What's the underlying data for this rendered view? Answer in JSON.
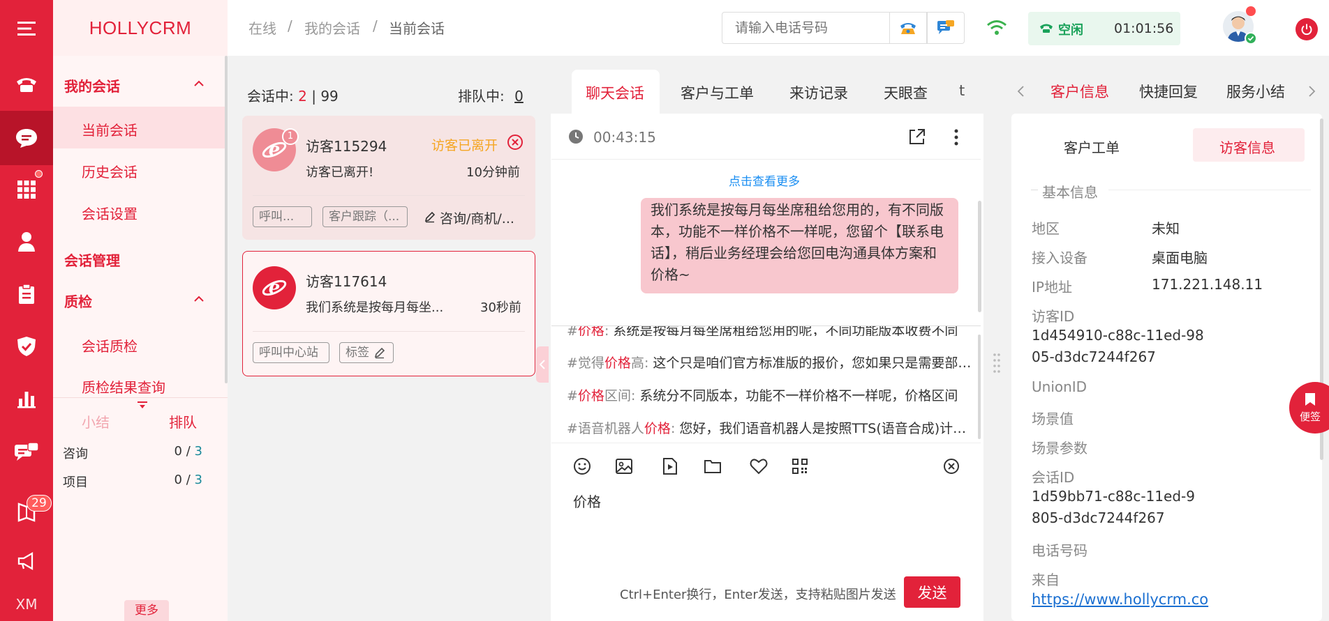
{
  "app": {
    "brand": "HOLLYCRM"
  },
  "colors": {
    "primary": "#e2223a",
    "online": "#1aa25a",
    "link": "#1a8ef2"
  },
  "rail": {
    "icons": [
      "menu-icon",
      "phone-icon",
      "chat-icon",
      "apps-icon",
      "user-icon",
      "clipboard-icon",
      "shield-icon",
      "chart-icon",
      "message-icon",
      "book-icon",
      "megaphone-icon"
    ],
    "badge": "29",
    "footer": "XM"
  },
  "nav": {
    "my_sessions": "我的会话",
    "current": "当前会话",
    "history": "历史会话",
    "settings": "会话设置",
    "management": "会话管理",
    "quality": "质检",
    "qc": "会话质检",
    "qc_result": "质检结果查询"
  },
  "stats": {
    "tab_summary": "小结",
    "tab_queue": "排队",
    "rows": [
      {
        "label": "咨询",
        "value": "0",
        "max": "3"
      },
      {
        "label": "项目",
        "value": "0",
        "max": "3"
      }
    ],
    "slash": "/",
    "more": "更多"
  },
  "header": {
    "crumbs": [
      "在线",
      "我的会话",
      "当前会话"
    ],
    "crumb_sep": "/",
    "phone_placeholder": "请输入电话号码",
    "status": "空闲",
    "timer": "01:01:56"
  },
  "conv": {
    "in_session_label": "会话中:",
    "in_session_count": "2",
    "in_session_sep": "|",
    "in_session_max": "99",
    "queue_label": "排队中:",
    "queue_count": "0",
    "items": [
      {
        "name": "访客115294",
        "status": "访客已离开",
        "badge": "1",
        "message": "访客已离开!",
        "time": "10分钟前",
        "tags": [
          "呼叫...",
          "客户跟踪（..."
        ],
        "edit_tag": "咨询/商机/..."
      },
      {
        "name": "访客117614",
        "message": "我们系统是按每月每坐...",
        "time": "30秒前",
        "tags": [
          "呼叫中心站"
        ],
        "edit_tag": "标签"
      }
    ]
  },
  "chat": {
    "tabs": [
      "聊天会话",
      "客户与工单",
      "来访记录",
      "天眼查",
      "t"
    ],
    "duration": "00:43:15",
    "see_more": "点击查看更多",
    "bubble": "我们系统是按每月每坐席租给您用的，有不同版本，功能不一样价格不一样呢，您留个【联系电话】，稍后业务经理会给您回电沟通具体方案和价格~",
    "quick_replies": [
      {
        "pre": "#",
        "hl": "价格",
        "post": ":",
        "text": "系统是按每月每坐席租给您用的呢，不同功能版本收费不同"
      },
      {
        "pre": "#觉得",
        "hl": "价格",
        "post": "高:",
        "text": "这个只是咱们官方标准版的报价，您如果只是需要部分功能"
      },
      {
        "pre": "#",
        "hl": "价格",
        "post": "区间:",
        "text": "系统分不同版本，功能不一样价格不一样呢，价格区间"
      },
      {
        "pre": "#语音机器人",
        "hl": "价格",
        "post": ":",
        "text": "您好，我们语音机器人是按照TTS(语音合成)计费的"
      }
    ],
    "draft": "价格",
    "hint": "Ctrl+Enter换行，Enter发送，支持粘贴图片发送",
    "send": "发送"
  },
  "right": {
    "tabs": [
      "客户信息",
      "快捷回复",
      "服务小结"
    ],
    "sub_tabs": [
      "客户工单",
      "访客信息"
    ],
    "section": "基本信息",
    "fields": {
      "region_label": "地区",
      "region": "未知",
      "device_label": "接入设备",
      "device": "桌面电脑",
      "ip_label": "IP地址",
      "ip": "171.221.148.11",
      "visitor_id_label": "访客ID",
      "visitor_id_1": "1d454910-c88c-11ed-98",
      "visitor_id_2": "05-d3dc7244f267",
      "union_label": "UnionID",
      "scene_label": "场景值",
      "scene_param_label": "场景参数",
      "session_id_label": "会话ID",
      "session_id_1": "1d59bb71-c88c-11ed-9",
      "session_id_2": "805-d3dc7244f267",
      "phone_label": "电话号码",
      "from_label": "来自",
      "from": "https://www.hollycrm.co"
    },
    "note": "便签"
  }
}
